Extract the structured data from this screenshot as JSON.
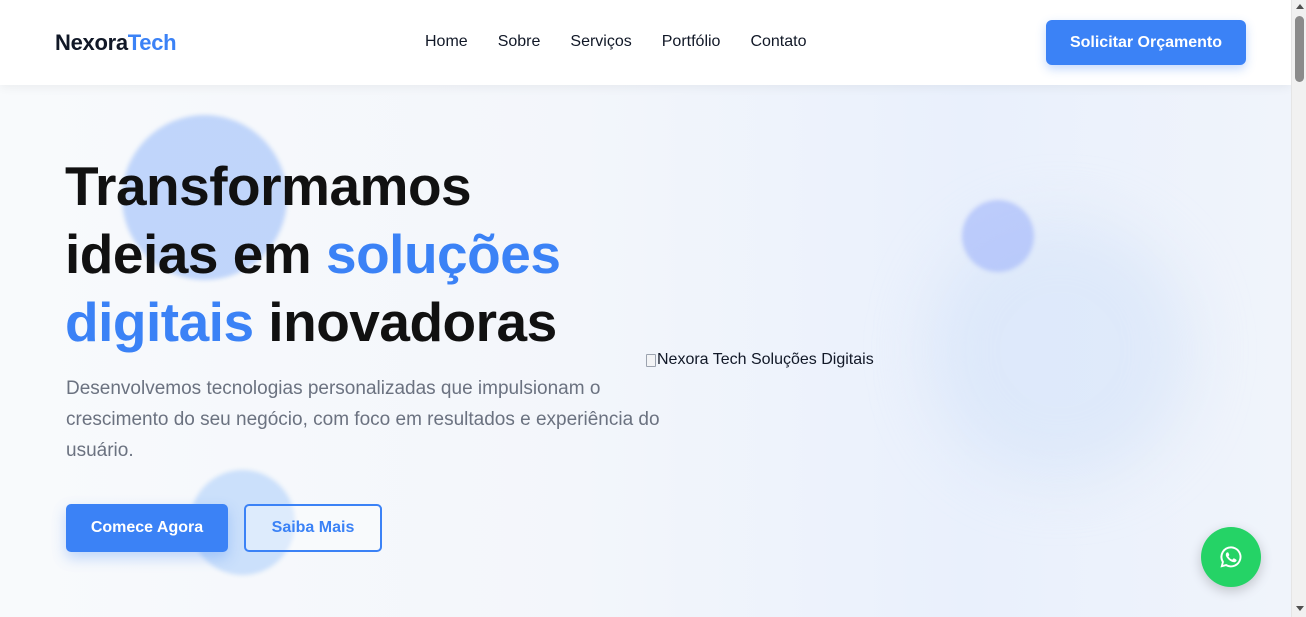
{
  "header": {
    "logo_part1": "Nexora",
    "logo_part2": "Tech",
    "nav": [
      "Home",
      "Sobre",
      "Serviços",
      "Portfólio",
      "Contato"
    ],
    "cta_label": "Solicitar Orçamento"
  },
  "hero": {
    "title_line1": "Transformamos",
    "title_line2_a": "ideias em ",
    "title_line2_b": "soluções",
    "title_line3_a": "digitais",
    "title_line3_b": " inovadoras",
    "subtitle": "Desenvolvemos tecnologias personalizadas que impulsionam o crescimento do seu negócio, com foco em resultados e experiência do usuário.",
    "primary_button": "Comece Agora",
    "secondary_button": "Saiba Mais",
    "image_alt": "Nexora Tech Soluções Digitais"
  },
  "colors": {
    "accent": "#3b82f6",
    "whatsapp": "#25d366"
  },
  "icons": {
    "floating_button": "whatsapp-icon"
  }
}
